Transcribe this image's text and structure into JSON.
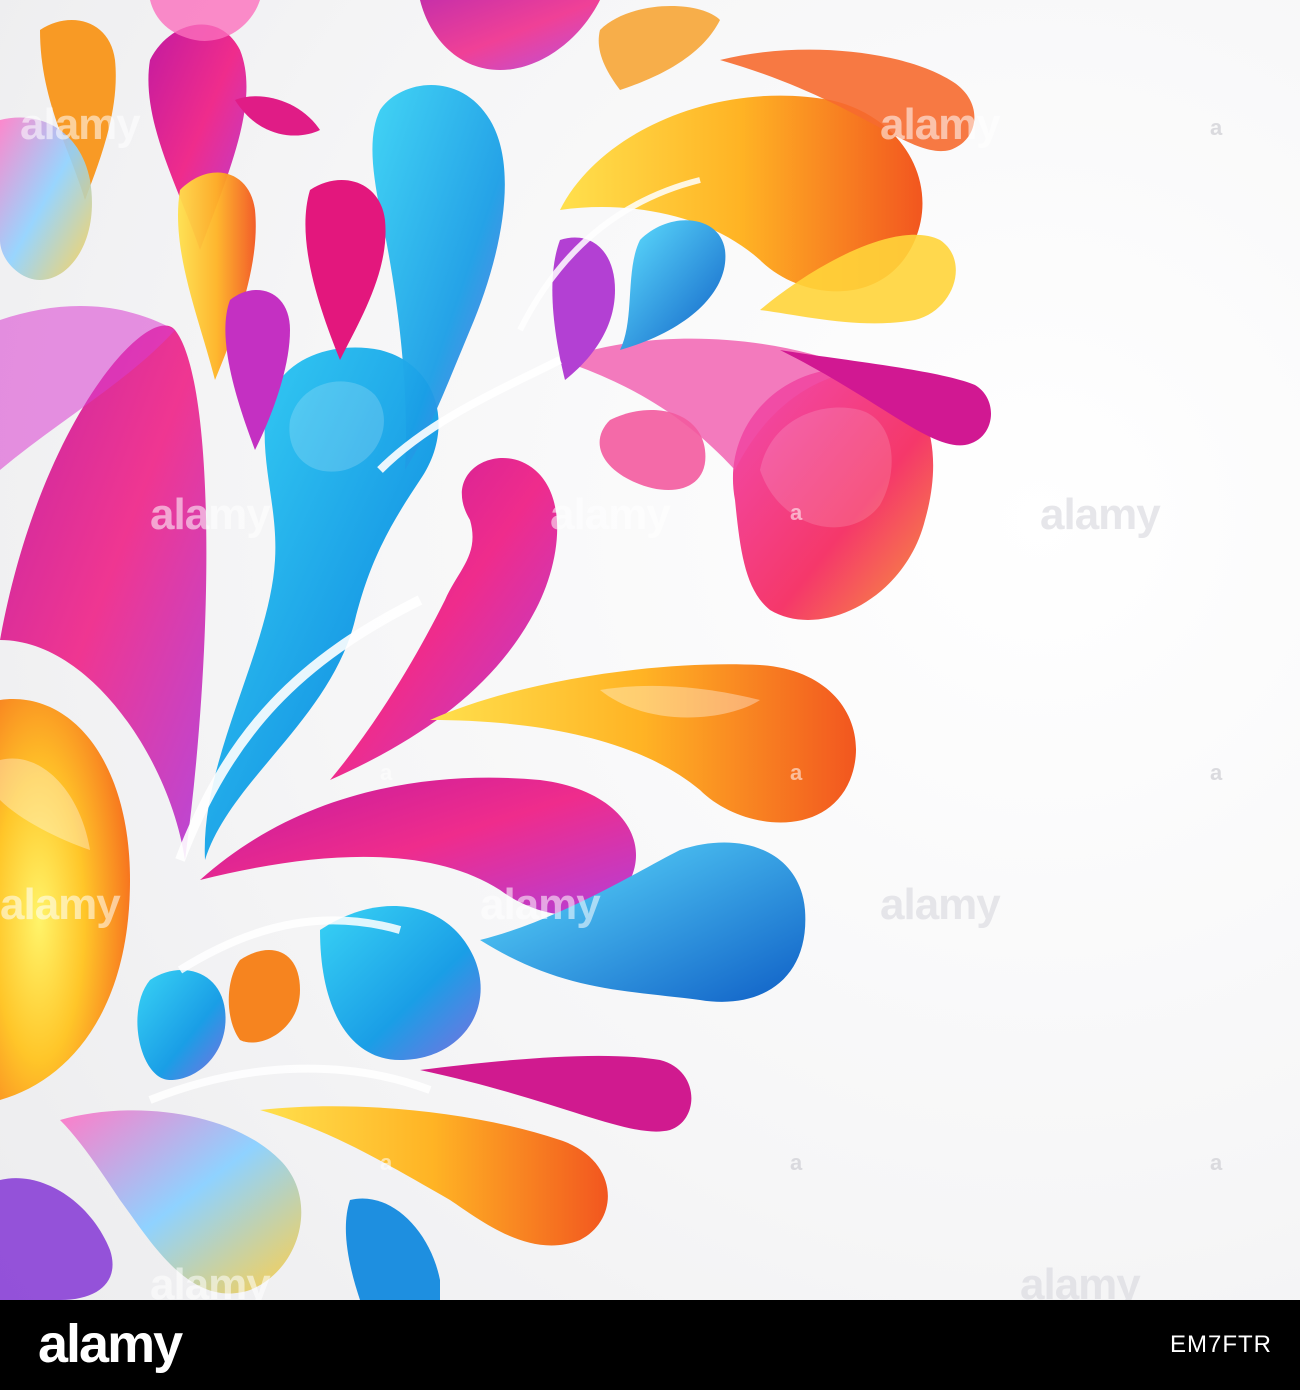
{
  "watermark": {
    "text": "alamy",
    "letter": "a"
  },
  "footer": {
    "brand": "alamy",
    "image_id": "EM7FTR"
  },
  "colors": {
    "magenta": "#e0168f",
    "pink": "#f2297a",
    "blue": "#1aa7e8",
    "cyan": "#35d0f2",
    "orange": "#f6841f",
    "yellow": "#ffd21a",
    "purple": "#9b3fd6",
    "footer": "#000000"
  }
}
